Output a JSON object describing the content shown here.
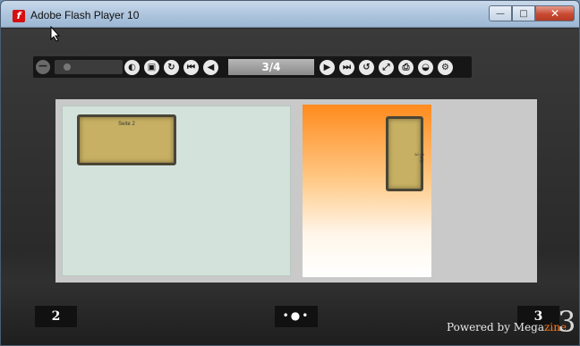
{
  "window": {
    "title": "Adobe Flash Player 10",
    "app_icon_glyph": "f",
    "controls": {
      "minimize": "—",
      "maximize": "□",
      "close": "✕"
    }
  },
  "toolbar": {
    "zoom_out_glyph": "−",
    "left_icons": [
      "speaker-icon",
      "fullscreen-icon",
      "rotate-icon",
      "first-page-icon",
      "prev-page-icon"
    ],
    "left_glyphs": [
      "◐",
      "▣",
      "↻",
      "⏮",
      "◀"
    ],
    "page_indicator": "3/4",
    "right_icons": [
      "next-page-icon",
      "last-page-icon",
      "autoplay-icon",
      "link-icon",
      "print-icon",
      "download-icon",
      "settings-icon"
    ],
    "right_glyphs": [
      "▶",
      "⏭",
      "↺",
      "⤢",
      "⎙",
      "◒",
      "⚙"
    ]
  },
  "book": {
    "left_card_label": "Seite 2",
    "right_card_label": "Seite 3"
  },
  "footer": {
    "left_page_number": "2",
    "right_page_number": "3",
    "nav_dots": "•●•",
    "powered_prefix": "Powered by Mega",
    "powered_suffix": "zine",
    "powered_mark": "3"
  },
  "colors": {
    "close_button": "#c94a33",
    "right_page_top": "#ff8b1e",
    "left_page": "#d4e2dc",
    "card": "#c7b063",
    "brand_accent": "#ff7a1a"
  }
}
